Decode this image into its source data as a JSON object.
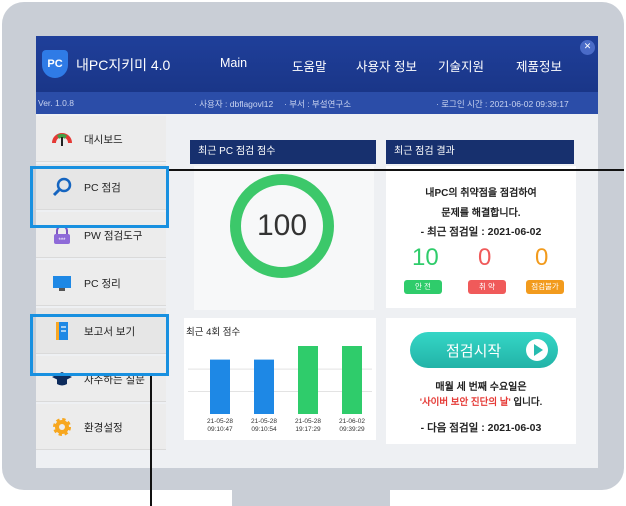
{
  "app": {
    "logo_text": "PC",
    "title": "내PC지키미 4.0",
    "version": "Ver. 1.0.8"
  },
  "nav": [
    {
      "label": "Main"
    },
    {
      "label": "도움말"
    },
    {
      "label": "사용자 정보"
    },
    {
      "label": "기술지원"
    },
    {
      "label": "제품정보"
    }
  ],
  "infobar": {
    "user": "· 사용자 : dbflagovl12",
    "dept": "· 부서 : 부설연구소",
    "login": "· 로그인 시간 : 2021-06-02 09:39:17"
  },
  "sidebar": {
    "items": [
      {
        "label": "대시보드",
        "icon": "gauge-icon"
      },
      {
        "label": "PC 점검",
        "icon": "magnifier-icon"
      },
      {
        "label": "PW 점검도구",
        "icon": "lock-icon"
      },
      {
        "label": "PC 정리",
        "icon": "monitor-icon"
      },
      {
        "label": "보고서 보기",
        "icon": "document-icon"
      },
      {
        "label": "자주하는 질문",
        "icon": "graduation-cap-icon"
      },
      {
        "label": "환경설정",
        "icon": "gear-icon"
      }
    ]
  },
  "score_panel": {
    "title": "최근 PC 점검 점수",
    "score": "100"
  },
  "result_panel": {
    "title": "최근 점검 결과",
    "line1": "내PC의 취약점을 점검하여",
    "line2": "문제를 해결합니다.",
    "last_check": "- 최근 점검일 : 2021-06-02",
    "safe_count": "10",
    "weak_count": "0",
    "fail_count": "0",
    "safe_label": "안 전",
    "weak_label": "취 약",
    "fail_label": "점검불가"
  },
  "history_panel": {
    "title": "최근 4회 점수"
  },
  "chart_data": {
    "type": "bar",
    "categories": [
      "21-05-28 09:10:47",
      "21-05-28 09:10:54",
      "21-05-28 19:17:29",
      "21-06-02 09:39:29"
    ],
    "category_lines": [
      [
        "21-05-28",
        "09:10:47"
      ],
      [
        "21-05-28",
        "09:10:54"
      ],
      [
        "21-05-28",
        "19:17:29"
      ],
      [
        "21-06-02",
        "09:39:29"
      ]
    ],
    "values": [
      80,
      80,
      100,
      100
    ],
    "bar_colors": [
      "#1e88e5",
      "#1e88e5",
      "#2fcc6b",
      "#2fcc6b"
    ],
    "ylim": [
      0,
      100
    ],
    "title": "최근 4회 점수"
  },
  "start_panel": {
    "button_label": "점검시작",
    "notice1": "매월 세 번째 수요일은",
    "notice2_highlight": "'사이버 보안 진단의 날'",
    "notice2_rest": " 입니다.",
    "next_check": "- 다음 점검일 : 2021-06-03"
  },
  "colors": {
    "header": "#1f3f9a",
    "safe": "#2fcc6b",
    "weak": "#f05a5a",
    "fail": "#f29b1d",
    "highlight": "#1890e0"
  }
}
